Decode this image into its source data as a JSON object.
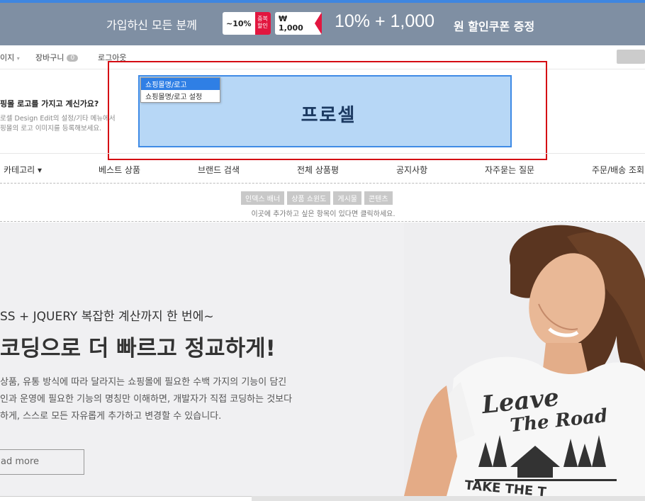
{
  "promo": {
    "text": "가입하신 모든 분께",
    "coupon1": {
      "value": "~10%",
      "tag": "중복 할인"
    },
    "coupon2": {
      "value": "₩ 1,000"
    },
    "headline": "10% + 1,000",
    "headline_sub": "원 할인쿠폰 증정",
    "colors": {
      "bg": "#7f8fa3",
      "accent": "#e2163f",
      "top_border": "#3f86e0"
    }
  },
  "util_bar": {
    "mypage": "이지",
    "cart": "장바구니",
    "cart_count": "0",
    "logout": "로그아웃"
  },
  "logo_area": {
    "help_title": "핑몰 로고를 가지고 계신가요?",
    "help_line1": "로셀 Design Edit의 설정/기타 메뉴에서",
    "help_line2": "핑몰의 로고 이미지를 등록해보세요.",
    "brand": "프로셀",
    "context_menu": [
      "쇼핑몰명/로고",
      "쇼핑몰명/로고 설정"
    ],
    "colors": {
      "box_bg": "#b7d7f6",
      "box_border": "#3f8be6",
      "frame": "#d50c13"
    }
  },
  "nav": {
    "items": [
      "카테고리 ▾",
      "베스트 상품",
      "브랜드 검색",
      "전체 상품평",
      "공지사항",
      "자주묻는 질문",
      "주문/배송 조회"
    ]
  },
  "edit_strip": {
    "buttons": [
      "인덱스 배너",
      "상품 쇼윈도",
      "게시물",
      "콘텐츠"
    ],
    "hint": "이곳에 추가하고 싶은 항목이 있다면 클릭하세요."
  },
  "hero": {
    "line1": "SS + JQUERY 복잡한 계산까지 한 번에~",
    "line2": "코딩으로 더 빠르고 정교하게!",
    "desc_line1": "상품, 유통 방식에 따라 달라지는 쇼핑몰에 필요한 수백 가지의 기능이 담긴",
    "desc_line2": "인과 운영에 필요한 기능의 명칭만 이해하면, 개발자가 직접 코딩하는 것보다",
    "desc_line3": "하게, 스스로 모든 자유롭게 추가하고 변경할 수 있습니다.",
    "button": "ad more",
    "shirt_text_1": "Leave",
    "shirt_text_2": "The Road",
    "shirt_text_3": "TAKE THE T"
  }
}
